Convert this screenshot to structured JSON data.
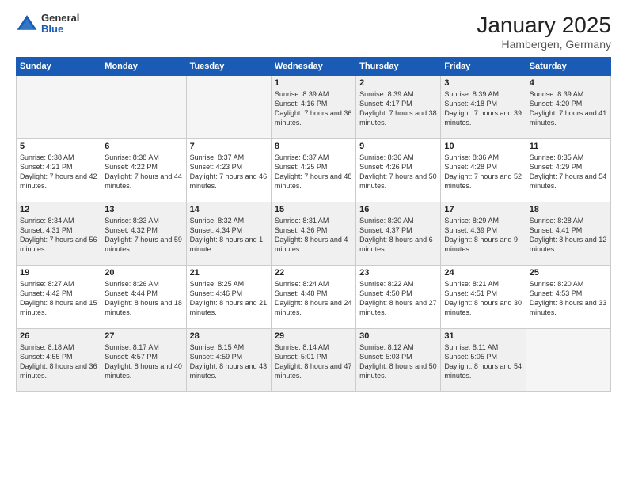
{
  "header": {
    "logo_general": "General",
    "logo_blue": "Blue",
    "month_title": "January 2025",
    "location": "Hambergen, Germany"
  },
  "weekdays": [
    "Sunday",
    "Monday",
    "Tuesday",
    "Wednesday",
    "Thursday",
    "Friday",
    "Saturday"
  ],
  "weeks": [
    [
      {
        "day": "",
        "text": ""
      },
      {
        "day": "",
        "text": ""
      },
      {
        "day": "",
        "text": ""
      },
      {
        "day": "1",
        "text": "Sunrise: 8:39 AM\nSunset: 4:16 PM\nDaylight: 7 hours\nand 36 minutes."
      },
      {
        "day": "2",
        "text": "Sunrise: 8:39 AM\nSunset: 4:17 PM\nDaylight: 7 hours\nand 38 minutes."
      },
      {
        "day": "3",
        "text": "Sunrise: 8:39 AM\nSunset: 4:18 PM\nDaylight: 7 hours\nand 39 minutes."
      },
      {
        "day": "4",
        "text": "Sunrise: 8:39 AM\nSunset: 4:20 PM\nDaylight: 7 hours\nand 41 minutes."
      }
    ],
    [
      {
        "day": "5",
        "text": "Sunrise: 8:38 AM\nSunset: 4:21 PM\nDaylight: 7 hours\nand 42 minutes."
      },
      {
        "day": "6",
        "text": "Sunrise: 8:38 AM\nSunset: 4:22 PM\nDaylight: 7 hours\nand 44 minutes."
      },
      {
        "day": "7",
        "text": "Sunrise: 8:37 AM\nSunset: 4:23 PM\nDaylight: 7 hours\nand 46 minutes."
      },
      {
        "day": "8",
        "text": "Sunrise: 8:37 AM\nSunset: 4:25 PM\nDaylight: 7 hours\nand 48 minutes."
      },
      {
        "day": "9",
        "text": "Sunrise: 8:36 AM\nSunset: 4:26 PM\nDaylight: 7 hours\nand 50 minutes."
      },
      {
        "day": "10",
        "text": "Sunrise: 8:36 AM\nSunset: 4:28 PM\nDaylight: 7 hours\nand 52 minutes."
      },
      {
        "day": "11",
        "text": "Sunrise: 8:35 AM\nSunset: 4:29 PM\nDaylight: 7 hours\nand 54 minutes."
      }
    ],
    [
      {
        "day": "12",
        "text": "Sunrise: 8:34 AM\nSunset: 4:31 PM\nDaylight: 7 hours\nand 56 minutes."
      },
      {
        "day": "13",
        "text": "Sunrise: 8:33 AM\nSunset: 4:32 PM\nDaylight: 7 hours\nand 59 minutes."
      },
      {
        "day": "14",
        "text": "Sunrise: 8:32 AM\nSunset: 4:34 PM\nDaylight: 8 hours\nand 1 minute."
      },
      {
        "day": "15",
        "text": "Sunrise: 8:31 AM\nSunset: 4:36 PM\nDaylight: 8 hours\nand 4 minutes."
      },
      {
        "day": "16",
        "text": "Sunrise: 8:30 AM\nSunset: 4:37 PM\nDaylight: 8 hours\nand 6 minutes."
      },
      {
        "day": "17",
        "text": "Sunrise: 8:29 AM\nSunset: 4:39 PM\nDaylight: 8 hours\nand 9 minutes."
      },
      {
        "day": "18",
        "text": "Sunrise: 8:28 AM\nSunset: 4:41 PM\nDaylight: 8 hours\nand 12 minutes."
      }
    ],
    [
      {
        "day": "19",
        "text": "Sunrise: 8:27 AM\nSunset: 4:42 PM\nDaylight: 8 hours\nand 15 minutes."
      },
      {
        "day": "20",
        "text": "Sunrise: 8:26 AM\nSunset: 4:44 PM\nDaylight: 8 hours\nand 18 minutes."
      },
      {
        "day": "21",
        "text": "Sunrise: 8:25 AM\nSunset: 4:46 PM\nDaylight: 8 hours\nand 21 minutes."
      },
      {
        "day": "22",
        "text": "Sunrise: 8:24 AM\nSunset: 4:48 PM\nDaylight: 8 hours\nand 24 minutes."
      },
      {
        "day": "23",
        "text": "Sunrise: 8:22 AM\nSunset: 4:50 PM\nDaylight: 8 hours\nand 27 minutes."
      },
      {
        "day": "24",
        "text": "Sunrise: 8:21 AM\nSunset: 4:51 PM\nDaylight: 8 hours\nand 30 minutes."
      },
      {
        "day": "25",
        "text": "Sunrise: 8:20 AM\nSunset: 4:53 PM\nDaylight: 8 hours\nand 33 minutes."
      }
    ],
    [
      {
        "day": "26",
        "text": "Sunrise: 8:18 AM\nSunset: 4:55 PM\nDaylight: 8 hours\nand 36 minutes."
      },
      {
        "day": "27",
        "text": "Sunrise: 8:17 AM\nSunset: 4:57 PM\nDaylight: 8 hours\nand 40 minutes."
      },
      {
        "day": "28",
        "text": "Sunrise: 8:15 AM\nSunset: 4:59 PM\nDaylight: 8 hours\nand 43 minutes."
      },
      {
        "day": "29",
        "text": "Sunrise: 8:14 AM\nSunset: 5:01 PM\nDaylight: 8 hours\nand 47 minutes."
      },
      {
        "day": "30",
        "text": "Sunrise: 8:12 AM\nSunset: 5:03 PM\nDaylight: 8 hours\nand 50 minutes."
      },
      {
        "day": "31",
        "text": "Sunrise: 8:11 AM\nSunset: 5:05 PM\nDaylight: 8 hours\nand 54 minutes."
      },
      {
        "day": "",
        "text": ""
      }
    ]
  ]
}
